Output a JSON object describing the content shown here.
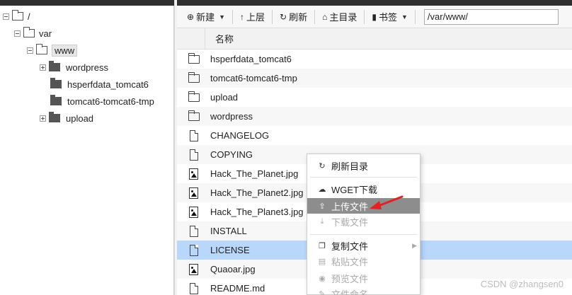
{
  "tree": {
    "root_label": "/",
    "items": [
      {
        "label": "var"
      },
      {
        "label": "www"
      },
      {
        "label": "wordpress"
      },
      {
        "label": "hsperfdata_tomcat6"
      },
      {
        "label": "tomcat6-tomcat6-tmp"
      },
      {
        "label": "upload"
      }
    ]
  },
  "toolbar": {
    "new_label": "新建",
    "up_label": "上层",
    "refresh_label": "刷新",
    "home_label": "主目录",
    "bookmark_label": "书签",
    "path_value": "/var/www/"
  },
  "grid": {
    "name_header": "名称",
    "rows": [
      {
        "name": "hsperfdata_tomcat6",
        "icon": "folder-icon"
      },
      {
        "name": "tomcat6-tomcat6-tmp",
        "icon": "folder-icon"
      },
      {
        "name": "upload",
        "icon": "folder-icon"
      },
      {
        "name": "wordpress",
        "icon": "folder-icon"
      },
      {
        "name": "CHANGELOG",
        "icon": "file-icon"
      },
      {
        "name": "COPYING",
        "icon": "file-icon"
      },
      {
        "name": "Hack_The_Planet.jpg",
        "icon": "image-file-icon"
      },
      {
        "name": "Hack_The_Planet2.jpg",
        "icon": "image-file-icon"
      },
      {
        "name": "Hack_The_Planet3.jpg",
        "icon": "image-file-icon"
      },
      {
        "name": "INSTALL",
        "icon": "file-icon"
      },
      {
        "name": "LICENSE",
        "icon": "file-icon"
      },
      {
        "name": "Quaoar.jpg",
        "icon": "image-file-icon"
      },
      {
        "name": "README.md",
        "icon": "file-icon"
      }
    ]
  },
  "context_menu": {
    "refresh_dir": "刷新目录",
    "wget_download": "WGET下载",
    "upload_file": "上传文件",
    "download_file": "下载文件",
    "copy_file": "复制文件",
    "paste_file": "粘贴文件",
    "preview_file": "预览文件",
    "file_rename": "文件命名"
  },
  "watermark": "CSDN @zhangsen0",
  "colors": {
    "selected_row": "#b9d6fb",
    "menu_hover": "#8d8d8d",
    "annotation_arrow": "#e32121"
  }
}
